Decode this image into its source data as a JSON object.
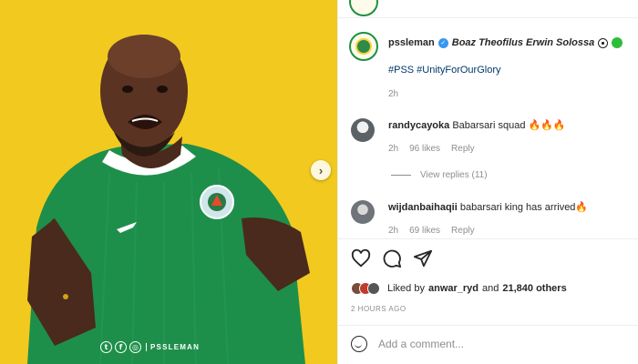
{
  "media": {
    "next_icon": "chevron-right-icon",
    "brand_text": "PSSLEMAN",
    "social_icons": [
      "twitter-icon",
      "facebook-icon",
      "instagram-icon"
    ],
    "jersey_color": "#1e8f4a",
    "background_color": "#f2c91f"
  },
  "top_cut": {
    "text": ""
  },
  "caption": {
    "username": "pssleman",
    "name": "Boaz Theofilus Erwin Solossa",
    "hashtags": "#PSS #UnityForOurGlory",
    "time": "2h"
  },
  "comments": [
    {
      "username": "randycayoka",
      "text": "Babarsari squad 🔥🔥🔥",
      "time": "2h",
      "likes": "96 likes",
      "reply": "Reply"
    },
    {
      "username": "wijdanbaihaqii",
      "text": "babarsari king has arrived🔥",
      "time": "2h",
      "likes": "69 likes",
      "reply": "Reply"
    }
  ],
  "view_replies": "View replies (11)",
  "likes": {
    "prefix": "Liked by",
    "user": "anwar_ryd",
    "conj": "and",
    "others": "21,840 others"
  },
  "posted_ago": "2 HOURS AGO",
  "add_comment": {
    "placeholder": "Add a comment..."
  },
  "colors": {
    "link": "#00376b",
    "muted": "#8e8e8e",
    "verified": "#3897f0"
  }
}
